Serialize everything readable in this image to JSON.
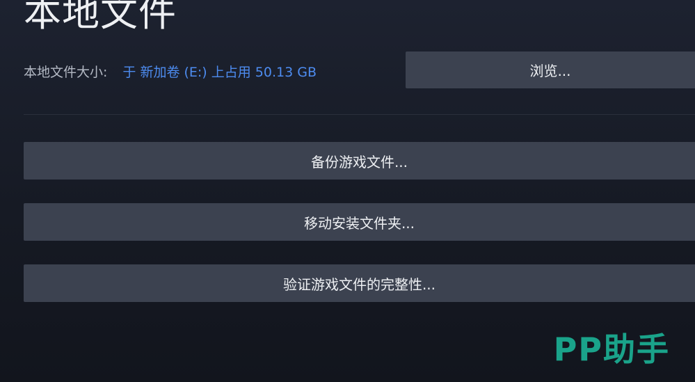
{
  "page": {
    "title": "本地文件"
  },
  "local_files": {
    "size_label": "本地文件大小:",
    "size_value": "于 新加卷 (E:) 上占用 50.13 GB",
    "browse_label": "浏览..."
  },
  "actions": {
    "backup_label": "备份游戏文件...",
    "move_label": "移动安装文件夹...",
    "verify_label": "验证游戏文件的完整性..."
  },
  "watermark": {
    "text": "PP助手"
  },
  "colors": {
    "background": "#161a24",
    "button": "#3c4250",
    "link_blue": "#4d8cf0",
    "watermark_green": "#1aa38a"
  }
}
